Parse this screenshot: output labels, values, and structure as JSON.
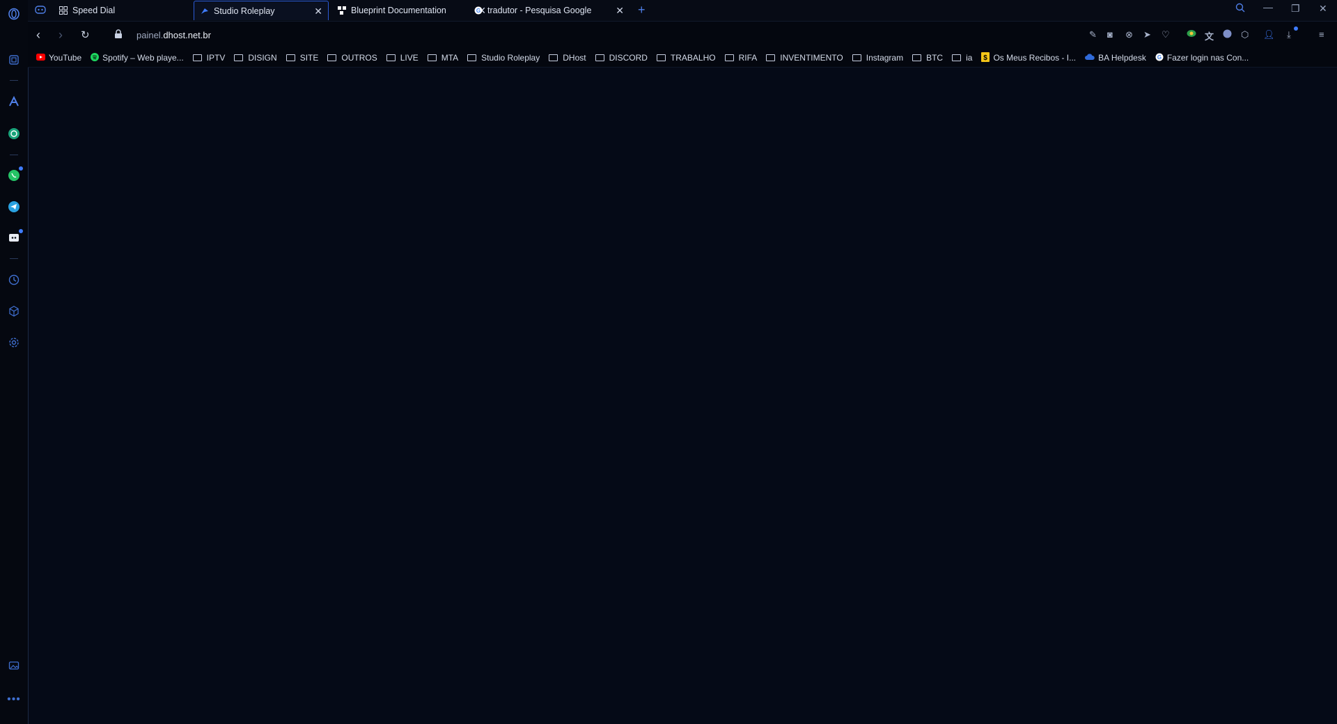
{
  "tabs": [
    {
      "title": "Speed Dial",
      "icon": "grid-icon",
      "active": false
    },
    {
      "title": "Studio Roleplay",
      "icon": "roleplay-logo-icon",
      "active": true
    },
    {
      "title": "Blueprint Documentation",
      "icon": "blueprint-icon",
      "active": false
    },
    {
      "title": "tradutor - Pesquisa Google",
      "icon": "google-icon",
      "active": false
    }
  ],
  "address": {
    "prefix": "painel.",
    "domain": "dhost.net.br"
  },
  "bookmarks": [
    {
      "label": "YouTube",
      "type": "site",
      "icon": "youtube-icon"
    },
    {
      "label": "Spotify – Web playe...",
      "type": "site",
      "icon": "spotify-icon"
    },
    {
      "label": "IPTV",
      "type": "folder"
    },
    {
      "label": "DISIGN",
      "type": "folder"
    },
    {
      "label": "SITE",
      "type": "folder"
    },
    {
      "label": "OUTROS",
      "type": "folder"
    },
    {
      "label": "LIVE",
      "type": "folder"
    },
    {
      "label": "MTA",
      "type": "folder"
    },
    {
      "label": "Studio Roleplay",
      "type": "folder"
    },
    {
      "label": "DHost",
      "type": "folder"
    },
    {
      "label": "DISCORD",
      "type": "folder"
    },
    {
      "label": "TRABALHO",
      "type": "folder"
    },
    {
      "label": "RIFA",
      "type": "folder"
    },
    {
      "label": "INVENTIMENTO",
      "type": "folder"
    },
    {
      "label": "Instagram",
      "type": "folder"
    },
    {
      "label": "BTC",
      "type": "folder"
    },
    {
      "label": "ia",
      "type": "folder"
    },
    {
      "label": "Os Meus Recibos - I...",
      "type": "site",
      "icon": "recibos-icon"
    },
    {
      "label": "BA Helpdesk",
      "type": "site",
      "icon": "cloud-icon"
    },
    {
      "label": "Fazer login nas Con...",
      "type": "site",
      "icon": "google-icon"
    }
  ],
  "colors": {
    "accent": "#2b5bd7",
    "background": "#050a17"
  }
}
